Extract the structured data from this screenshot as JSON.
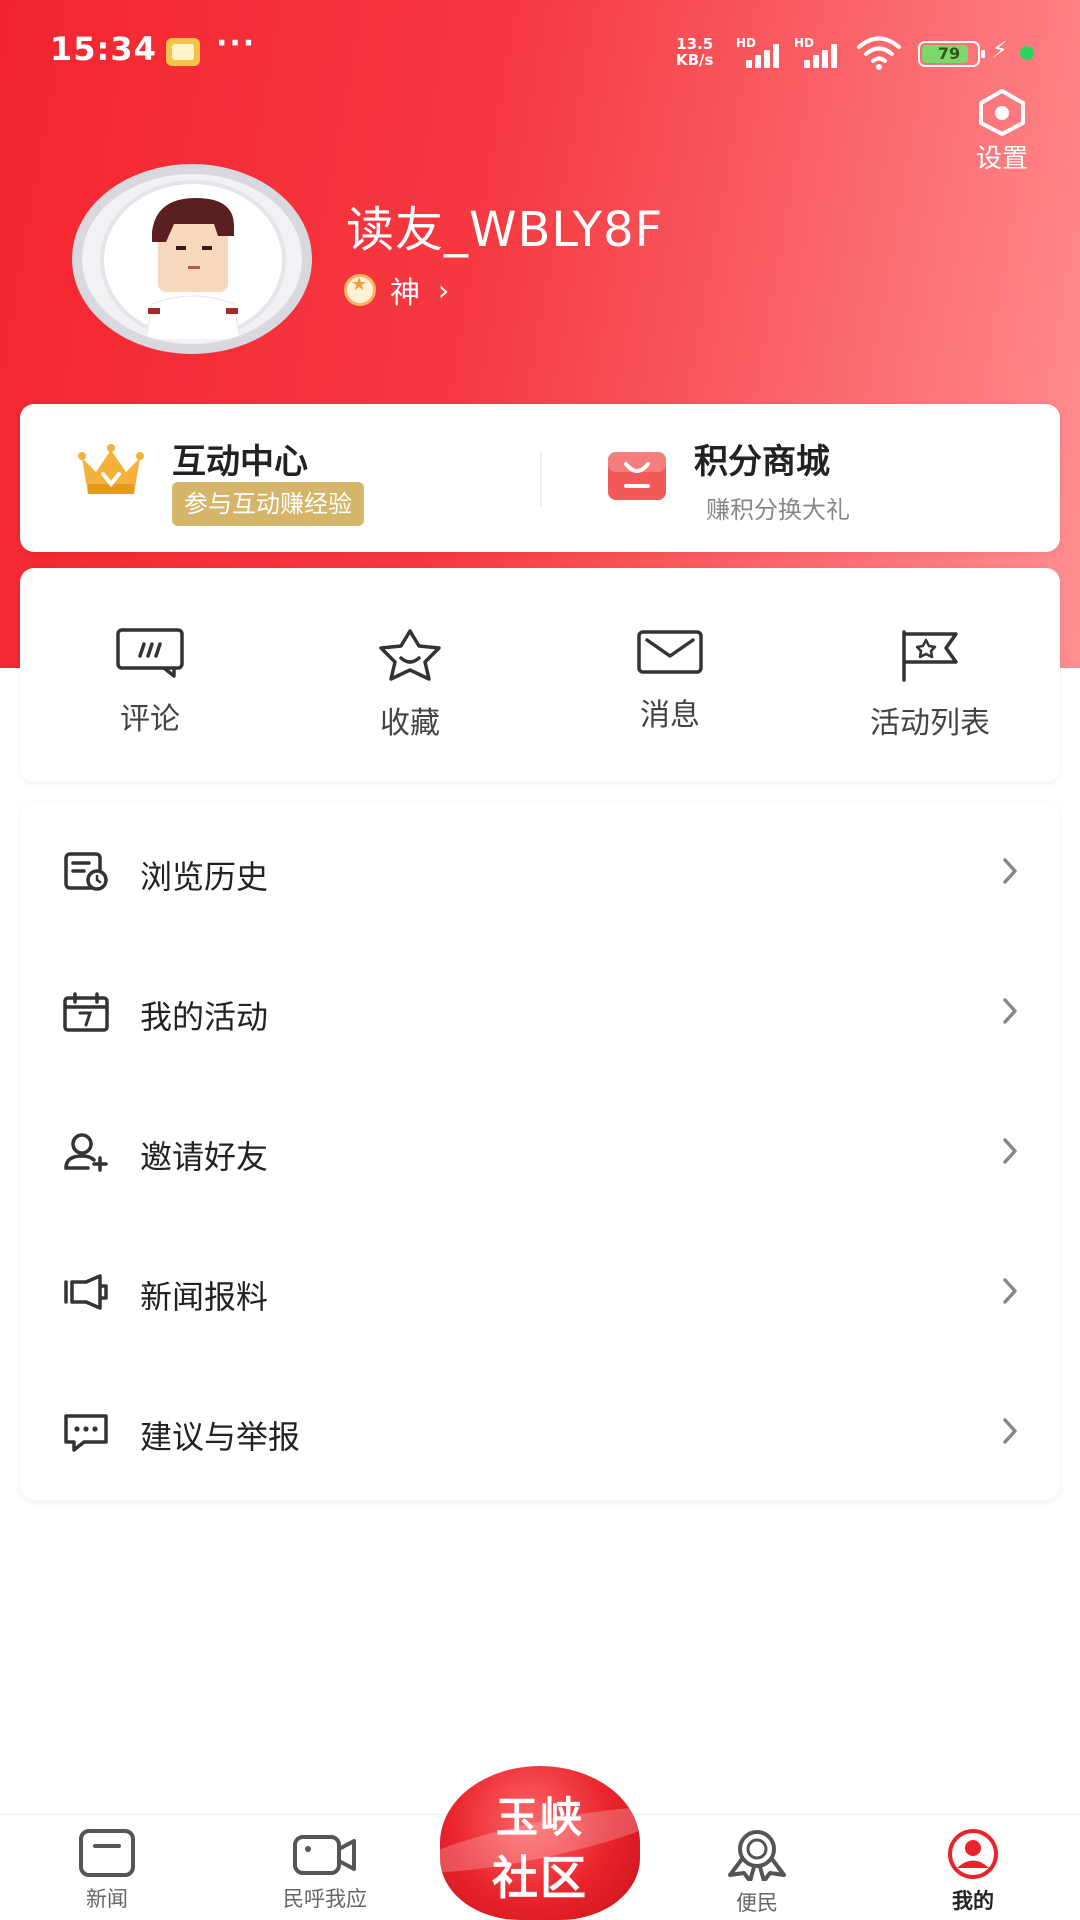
{
  "status_bar": {
    "time": "15:34",
    "dots": "···",
    "speed_top": "13.5",
    "speed_bottom": "KB/s",
    "sim1_label": "HD",
    "sim2_label": "HD",
    "battery": "79"
  },
  "profile": {
    "settings_label": "设置",
    "username": "读友_WBLY8F",
    "level": "神"
  },
  "promo": {
    "left_title": "互动中心",
    "left_badge": "参与互动赚经验",
    "right_title": "积分商城",
    "right_subtitle": "赚积分换大礼"
  },
  "shortcuts": [
    {
      "label": "评论",
      "icon": "comment-icon"
    },
    {
      "label": "收藏",
      "icon": "star-icon"
    },
    {
      "label": "消息",
      "icon": "mail-icon"
    },
    {
      "label": "活动列表",
      "icon": "flag-icon"
    }
  ],
  "menu": [
    {
      "label": "浏览历史",
      "icon": "history-icon"
    },
    {
      "label": "我的活动",
      "icon": "calendar-icon"
    },
    {
      "label": "邀请好友",
      "icon": "add-user-icon"
    },
    {
      "label": "新闻报料",
      "icon": "megaphone-icon"
    },
    {
      "label": "建议与举报",
      "icon": "feedback-icon"
    }
  ],
  "bottom_nav": {
    "news": "新闻",
    "voice": "民呼我应",
    "center_line1": "玉峡",
    "center_line2": "社区",
    "service": "便民",
    "mine": "我的"
  },
  "colors": {
    "brand_red": "#f3242f",
    "badge_gold": "#d4b56a"
  }
}
